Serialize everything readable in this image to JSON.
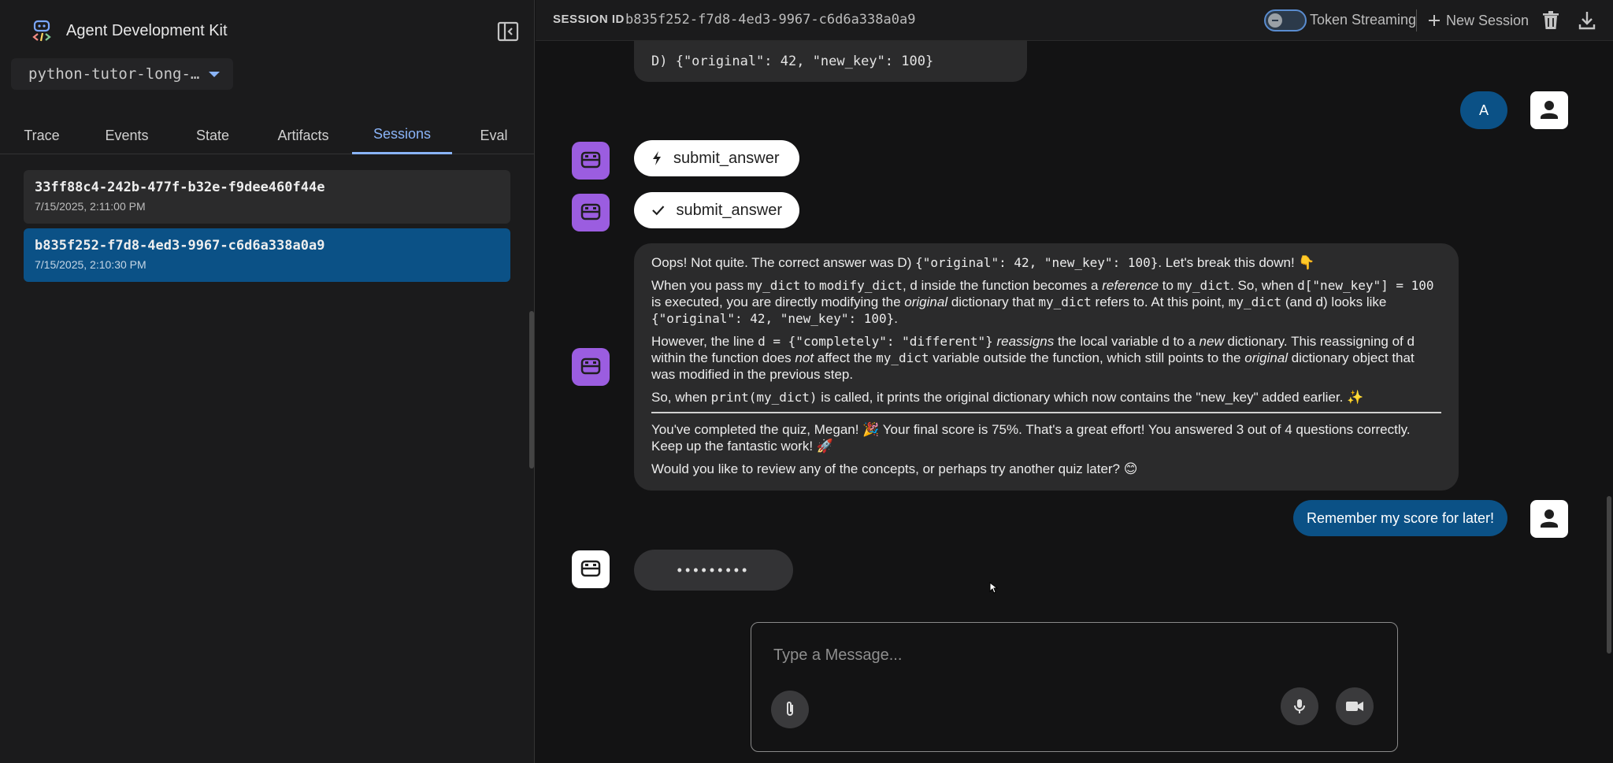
{
  "app": {
    "title": "Agent Development Kit",
    "selected_app": "python-tutor-long-…"
  },
  "tabs": [
    "Trace",
    "Events",
    "State",
    "Artifacts",
    "Sessions",
    "Eval"
  ],
  "sessions": [
    {
      "id": "33ff88c4-242b-477f-b32e-f9dee460f44e",
      "time": "7/15/2025, 2:11:00 PM"
    },
    {
      "id": "b835f252-f7d8-4ed3-9967-c6d6a338a0a9",
      "time": "7/15/2025, 2:10:30 PM"
    }
  ],
  "header": {
    "session_label": "SESSION ID",
    "session_id": "b835f252-f7d8-4ed3-9967-c6d6a338a0a9",
    "token_streaming": "Token Streaming",
    "new_session": "New Session"
  },
  "chat": {
    "prev_option": "D) {\"original\": 42, \"new_key\": 100}",
    "user_answer": "A",
    "function_call": "submit_answer",
    "function_response": "submit_answer",
    "response": {
      "p1_a": "Oops! Not quite. The correct answer was D) ",
      "p1_code": "{\"original\": 42, \"new_key\": 100}",
      "p1_b": ". Let's break this down! 👇",
      "p2_a": "When you pass ",
      "p2_c1": "my_dict",
      "p2_b": " to ",
      "p2_c2": "modify_dict",
      "p2_c": ", d inside the function becomes a ",
      "p2_em1": "reference",
      "p2_d": " to ",
      "p2_c3": "my_dict",
      "p2_e": ". So, when ",
      "p2_c4": "d[\"new_key\"] = 100",
      "p2_f": " is executed, you are directly modifying the ",
      "p2_em2": "original",
      "p2_g": " dictionary that ",
      "p2_c5": "my_dict",
      "p2_h": " refers to. At this point, ",
      "p2_c6": "my_dict",
      "p2_i": " (and d) looks like ",
      "p2_c7": "{\"original\": 42, \"new_key\": 100}",
      "p2_j": ".",
      "p3_a": "However, the line ",
      "p3_c1": "d = {\"completely\": \"different\"}",
      "p3_em1": " reassigns",
      "p3_b": " the local variable d to a ",
      "p3_em2": "new",
      "p3_c": " dictionary. This reassigning of d within the function does ",
      "p3_em3": "not",
      "p3_d": " affect the ",
      "p3_c2": "my_dict",
      "p3_e": " variable outside the function, which still points to the ",
      "p3_em4": "original",
      "p3_f": " dictionary object that was modified in the previous step.",
      "p4_a": "So, when ",
      "p4_c1": "print(my_dict)",
      "p4_b": " is called, it prints the original dictionary which now contains the \"new_key\" added earlier. ✨",
      "p5": "You've completed the quiz, Megan! 🎉 Your final score is 75%. That's a great effort! You answered 3 out of 4 questions correctly. Keep up the fantastic work! 🚀",
      "p6": "Would you like to review any of the concepts, or perhaps try another quiz later? 😊"
    },
    "user_message": "Remember my score for later!",
    "typing": "•••••••••"
  },
  "input": {
    "placeholder": "Type a Message..."
  },
  "colors": {
    "accent": "#8ab4f8",
    "selected_session": "#0b5186",
    "bot_avatar": "#9b5de0",
    "user_bubble": "#0b5186"
  }
}
